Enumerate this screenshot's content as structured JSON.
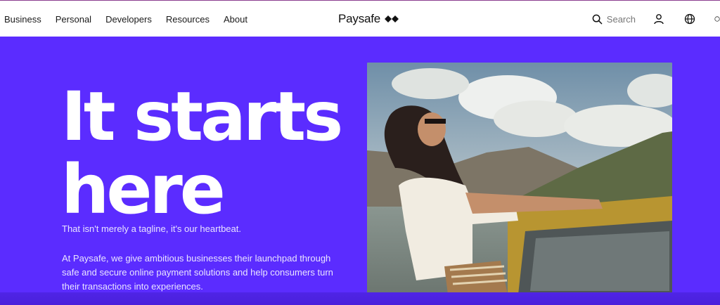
{
  "nav": {
    "items": [
      {
        "label": "Business"
      },
      {
        "label": "Personal"
      },
      {
        "label": "Developers"
      },
      {
        "label": "Resources"
      },
      {
        "label": "About"
      }
    ]
  },
  "brand": {
    "name": "Paysafe",
    "mark_icon": "paysafe-diamond-mark-icon"
  },
  "tools": {
    "search_label": "Search",
    "search_icon": "search-icon",
    "account_icon": "user-icon",
    "language_icon": "globe-icon"
  },
  "hero": {
    "headline_line1": "It starts",
    "headline_line2": "here",
    "tagline": "That isn't merely a tagline, it's our heartbeat.",
    "body": "At Paysafe, we give ambitious businesses their launchpad through safe and secure online payment solutions and help consumers turn their transactions into experiences."
  },
  "colors": {
    "hero_bg": "#5b2cff",
    "header_bg": "#ffffff",
    "text_light": "#ffffff"
  }
}
